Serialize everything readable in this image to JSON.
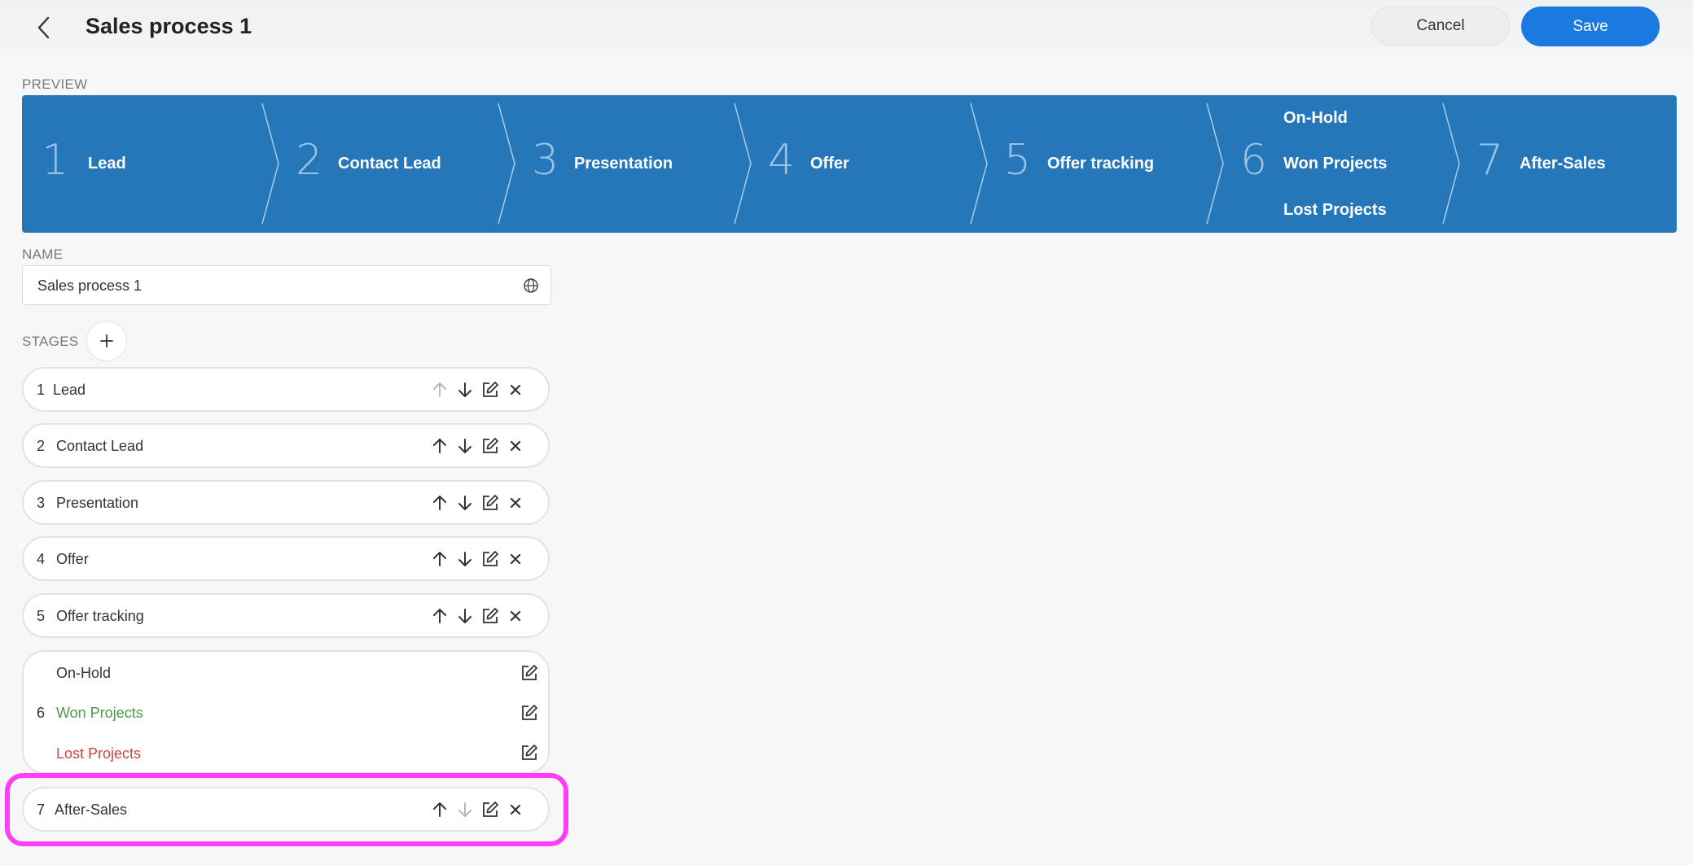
{
  "header": {
    "title": "Sales process 1",
    "cancel_label": "Cancel",
    "save_label": "Save",
    "back_icon": "chevron-left-icon"
  },
  "preview": {
    "label": "PREVIEW",
    "stages": [
      {
        "number": "1",
        "name": "Lead"
      },
      {
        "number": "2",
        "name": "Contact Lead"
      },
      {
        "number": "3",
        "name": "Presentation"
      },
      {
        "number": "4",
        "name": "Offer"
      },
      {
        "number": "5",
        "name": "Offer tracking"
      },
      {
        "number": "6",
        "names": [
          "On-Hold",
          "Won Projects",
          "Lost Projects"
        ]
      },
      {
        "number": "7",
        "name": "After-Sales"
      }
    ]
  },
  "name_field": {
    "label": "NAME",
    "value": "Sales process 1",
    "icon": "globe-icon"
  },
  "stages_section": {
    "label": "STAGES",
    "add_icon": "plus-icon",
    "rows": [
      {
        "number": "1",
        "label": "Lead"
      },
      {
        "number": "2",
        "label": "Contact Lead"
      },
      {
        "number": "3",
        "label": "Presentation"
      },
      {
        "number": "4",
        "label": "Offer"
      },
      {
        "number": "5",
        "label": "Offer tracking"
      }
    ],
    "final_stage": {
      "number": "6",
      "outcomes": [
        {
          "label": "On-Hold",
          "color": "#333333"
        },
        {
          "label": "Won Projects",
          "color": "#4a9a4a"
        },
        {
          "label": "Lost Projects",
          "color": "#d0453c"
        }
      ]
    },
    "last_row": {
      "number": "7",
      "label": "After-Sales"
    }
  },
  "colors": {
    "accent": "#1b7ae0",
    "preview_bg": "#2677ba",
    "highlight": "#ff3df5"
  }
}
